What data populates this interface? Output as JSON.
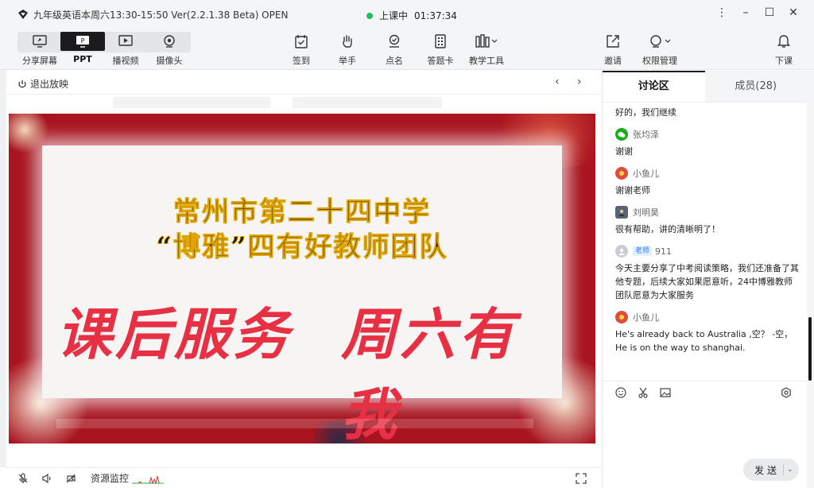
{
  "window": {
    "title": "九年级英语本周六13:30-15:50 Ver(2.2.1.38 Beta)  OPEN",
    "status_label": "上课中",
    "timer": "01:37:34"
  },
  "toolbar": {
    "left": [
      {
        "label": "分享屏幕",
        "icon": "screen-share-icon"
      },
      {
        "label": "PPT",
        "icon": "ppt-icon",
        "active": true
      },
      {
        "label": "播视频",
        "icon": "video-play-icon"
      },
      {
        "label": "摄像头",
        "icon": "camera-icon"
      }
    ],
    "center": [
      {
        "label": "签到",
        "icon": "check-in-icon"
      },
      {
        "label": "举手",
        "icon": "raise-hand-icon"
      },
      {
        "label": "点名",
        "icon": "roll-call-icon"
      },
      {
        "label": "答题卡",
        "icon": "answer-card-icon"
      },
      {
        "label": "教学工具",
        "icon": "teaching-tools-icon"
      }
    ],
    "right": [
      {
        "label": "邀请",
        "icon": "invite-icon"
      },
      {
        "label": "权限管理",
        "icon": "permission-icon"
      },
      {
        "label": "下课",
        "icon": "end-class-icon"
      }
    ]
  },
  "subbar": {
    "exit_label": "退出放映"
  },
  "slide": {
    "line1": "常州市第二十四中学",
    "line2": "“博雅”四有好教师团队",
    "big_left": "课后服务",
    "big_right": "周六有我"
  },
  "bottombar": {
    "resource_label": "资源监控"
  },
  "panel": {
    "tab_discussion": "讨论区",
    "tab_members": "成员(28)",
    "top_text": "好的，我们继续",
    "messages": [
      {
        "name": "张均泽",
        "text": "谢谢",
        "avatar_color": "#1aad19"
      },
      {
        "name": "小鱼儿",
        "text": "谢谢老师",
        "avatar_color": "#e34b3d"
      },
      {
        "name": "刘明昊",
        "text": "很有帮助，讲的清晰明了！",
        "avatar_color": "#5a6470"
      },
      {
        "name": "911",
        "badge": "老师",
        "text": "今天主要分享了中考阅读策略，我们还准备了其他专题，后续大家如果愿意听，24中博雅教师团队愿意为大家服务",
        "avatar_color": "#c9ccd1"
      },
      {
        "name": "小鱼儿",
        "text": "He's already back to Australia ,空？ -空，He is on the way to shanghai.",
        "avatar_color": "#e34b3d"
      }
    ],
    "send_label": "发送"
  }
}
